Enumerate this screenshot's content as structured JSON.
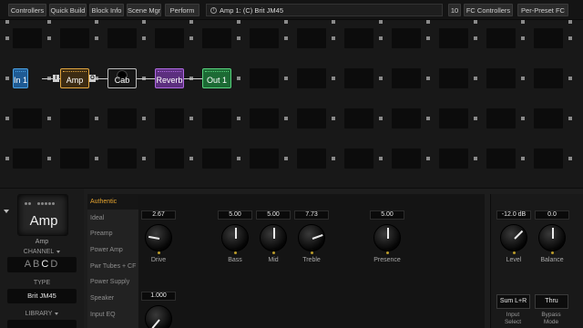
{
  "toolbar": {
    "controllers": "Controllers",
    "quick_build": "Quick Build",
    "block_info": "Block Info",
    "scene_mgr": "Scene Mgr",
    "perform": "Perform",
    "preset_name": "Amp 1: (C) Brit JM45",
    "preset_number": "10",
    "fc_controllers": "FC Controllers",
    "per_preset_fc": "Per-Preset FC"
  },
  "grid": {
    "blocks": [
      {
        "label": "In 1",
        "color": "#1f5b94"
      },
      {
        "label": "Amp",
        "color": "#3c2b12"
      },
      {
        "label": "Cab",
        "color": "#161616"
      },
      {
        "label": "Reverb",
        "color": "#5c2f7e"
      },
      {
        "label": "Out 1",
        "color": "#1c6a34"
      }
    ],
    "amp_input_port": "I",
    "amp_output_port": "O"
  },
  "block": {
    "tile_title": "Amp",
    "name": "Amp",
    "channel_label": "CHANNEL",
    "channels": [
      "A",
      "B",
      "C",
      "D"
    ],
    "selected_channel": "C",
    "type_label": "TYPE",
    "type_value": "Brit JM45",
    "library_label": "LIBRARY"
  },
  "sidebar": {
    "items": [
      {
        "label": "Authentic",
        "active": true
      },
      {
        "label": "Ideal"
      },
      {
        "label": "Preamp"
      },
      {
        "label": "Power Amp"
      },
      {
        "label": "Pwr Tubes + CF"
      },
      {
        "label": "Power Supply"
      },
      {
        "label": "Speaker"
      },
      {
        "label": "Input EQ"
      }
    ]
  },
  "params": {
    "drive": {
      "label": "Drive",
      "value": "2.67"
    },
    "bass": {
      "label": "Bass",
      "value": "5.00"
    },
    "mid": {
      "label": "Mid",
      "value": "5.00"
    },
    "treble": {
      "label": "Treble",
      "value": "7.73"
    },
    "presence": {
      "label": "Presence",
      "value": "5.00"
    },
    "second_row_value": "1.000"
  },
  "output": {
    "level": {
      "label": "Level",
      "value": "-12.0 dB"
    },
    "balance": {
      "label": "Balance",
      "value": "0.0"
    },
    "input_select_value": "Sum L+R",
    "input_select_label_1": "Input",
    "input_select_label_2": "Select",
    "bypass_mode_value": "Thru",
    "bypass_mode_label_1": "Bypass",
    "bypass_mode_label_2": "Mode"
  },
  "colors": {
    "accent": "#e7a52f",
    "knob_ring": "#b99a2a"
  }
}
